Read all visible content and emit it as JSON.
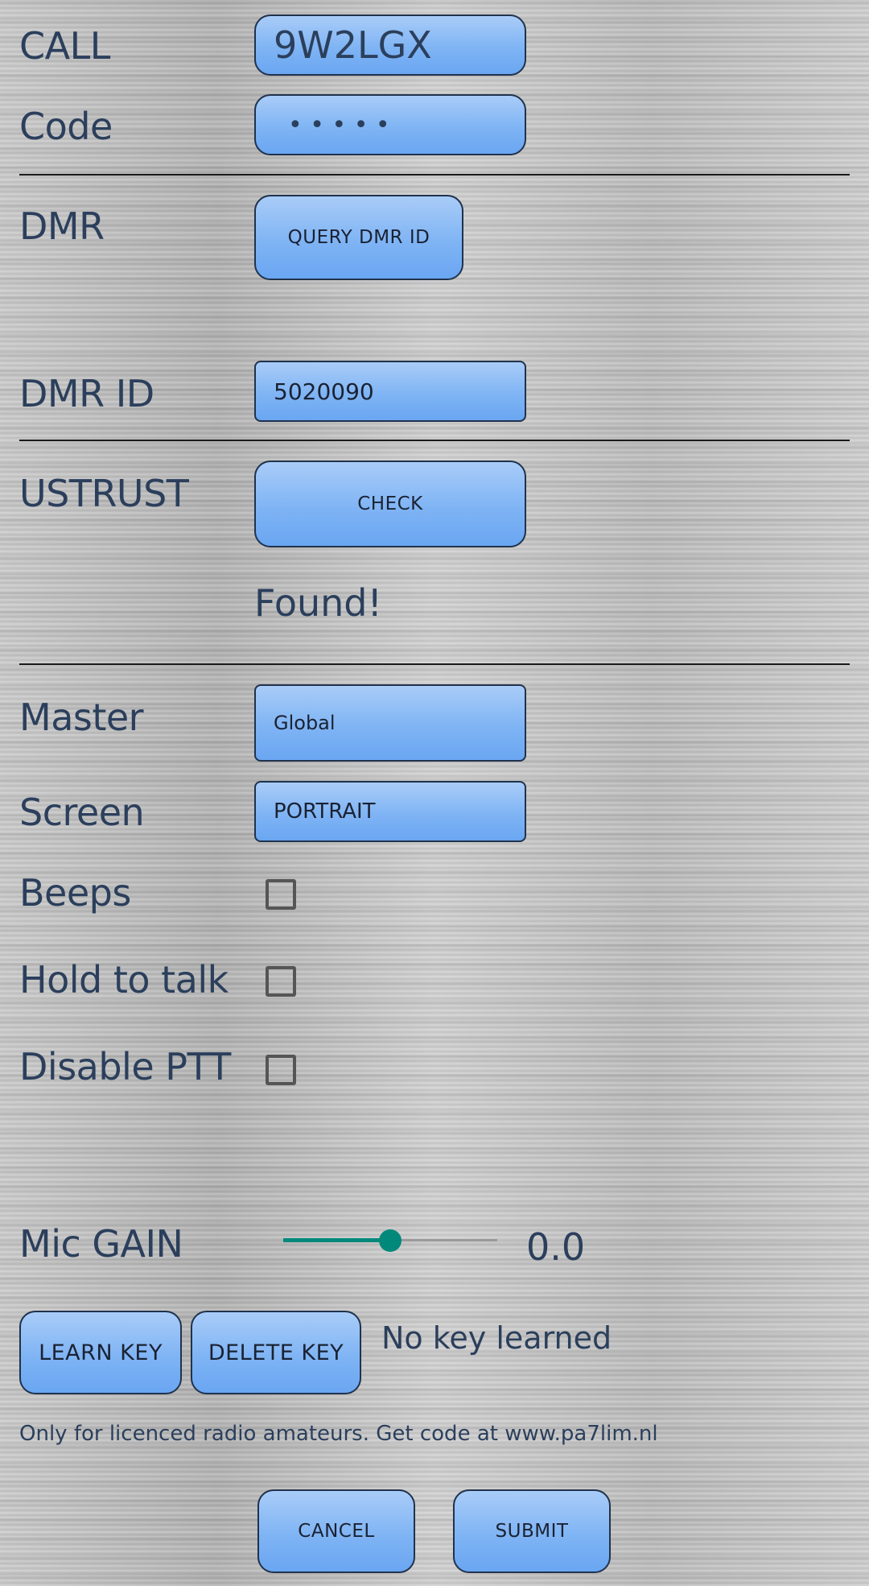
{
  "form": {
    "call": {
      "label": "CALL",
      "value": "9W2LGX"
    },
    "code": {
      "label": "Code",
      "value": "•  •  •  •  •"
    },
    "dmr": {
      "label": "DMR",
      "button": "QUERY DMR ID"
    },
    "dmr_id": {
      "label": "DMR ID",
      "value": "5020090"
    },
    "ustrust": {
      "label": "USTRUST",
      "button": "CHECK",
      "status": "Found!"
    },
    "master": {
      "label": "Master",
      "value": "Global"
    },
    "screen": {
      "label": "Screen",
      "value": "PORTRAIT"
    },
    "beeps": {
      "label": "Beeps",
      "checked": false
    },
    "hold_to_talk": {
      "label": "Hold to talk",
      "checked": false
    },
    "disable_ptt": {
      "label": "Disable PTT",
      "checked": false
    },
    "mic_gain": {
      "label": "Mic GAIN",
      "value": "0.0",
      "slider_fraction": 0.5,
      "accent": "#00897b"
    },
    "keys": {
      "learn": "LEARN KEY",
      "delete": "DELETE KEY",
      "status": "No key learned"
    },
    "footer_note": "Only for licenced radio amateurs. Get code at www.pa7lim.nl",
    "actions": {
      "cancel": "CANCEL",
      "submit": "SUBMIT"
    }
  }
}
